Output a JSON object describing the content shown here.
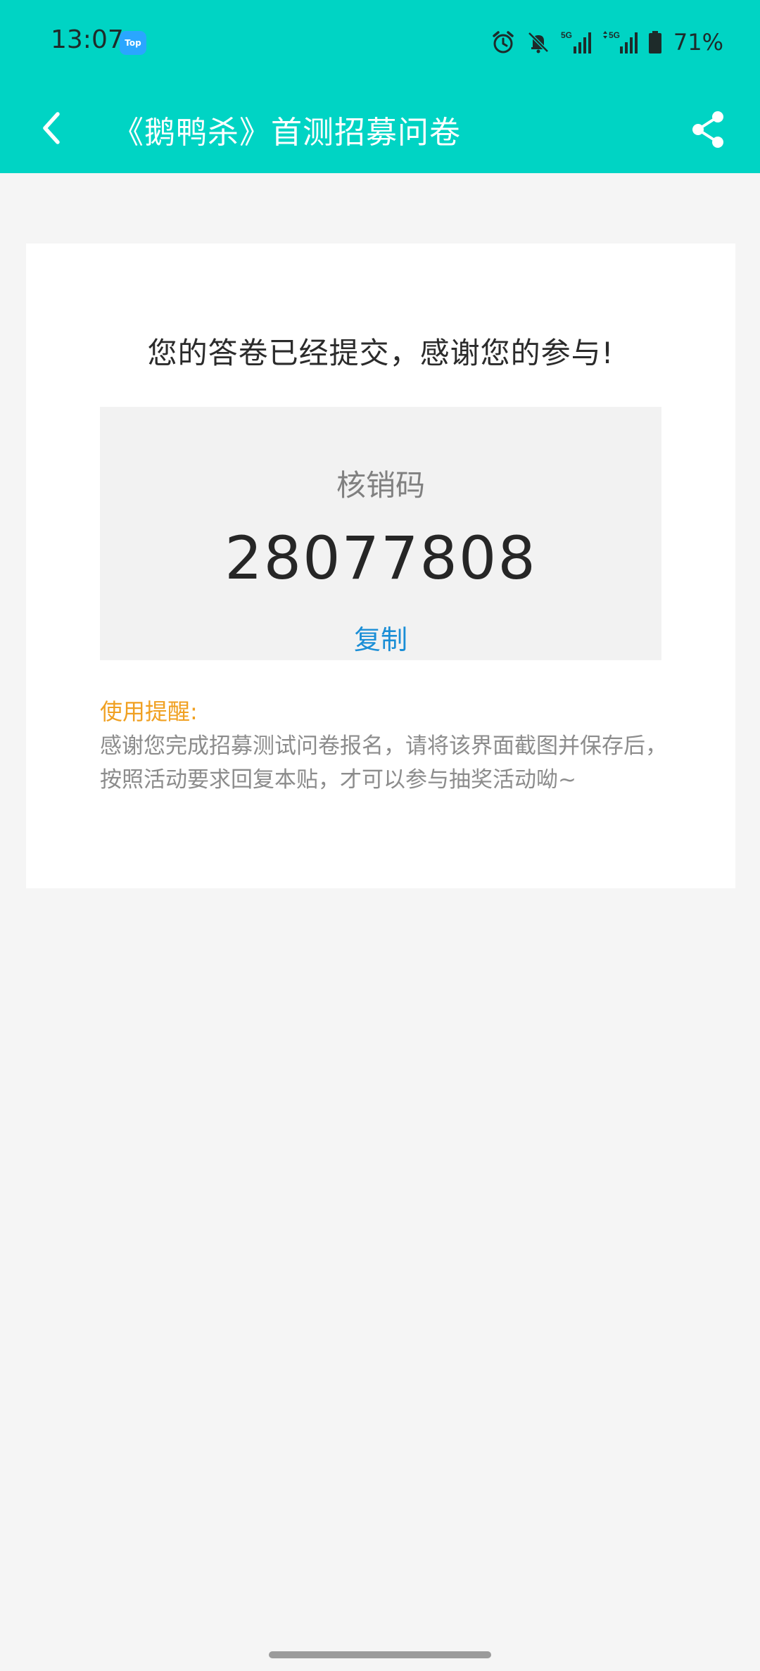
{
  "status_bar": {
    "time": "13:07",
    "app_badge": "Top",
    "battery_percent": "71%",
    "icons": [
      "alarm-icon",
      "mute-icon",
      "signal-5g-icon",
      "signal-5g-icon",
      "battery-icon"
    ]
  },
  "app_bar": {
    "title": "《鹅鸭杀》首测招募问卷",
    "back_icon": "chevron-left-icon",
    "share_icon": "share-icon"
  },
  "card": {
    "message": "您的答卷已经提交，感谢您的参与!",
    "code_label": "核销码",
    "code_value": "28077808",
    "copy_label": "复制",
    "reminder_title": "使用提醒:",
    "reminder_text": "感谢您完成招募测试问卷报名，请将该界面截图并保存后，按照活动要求回复本贴，才可以参与抽奖活动呦~"
  },
  "colors": {
    "header_bg": "#00d4c4",
    "page_bg": "#f5f5f5",
    "link": "#1a8ed6",
    "reminder_title": "#f0a021"
  }
}
